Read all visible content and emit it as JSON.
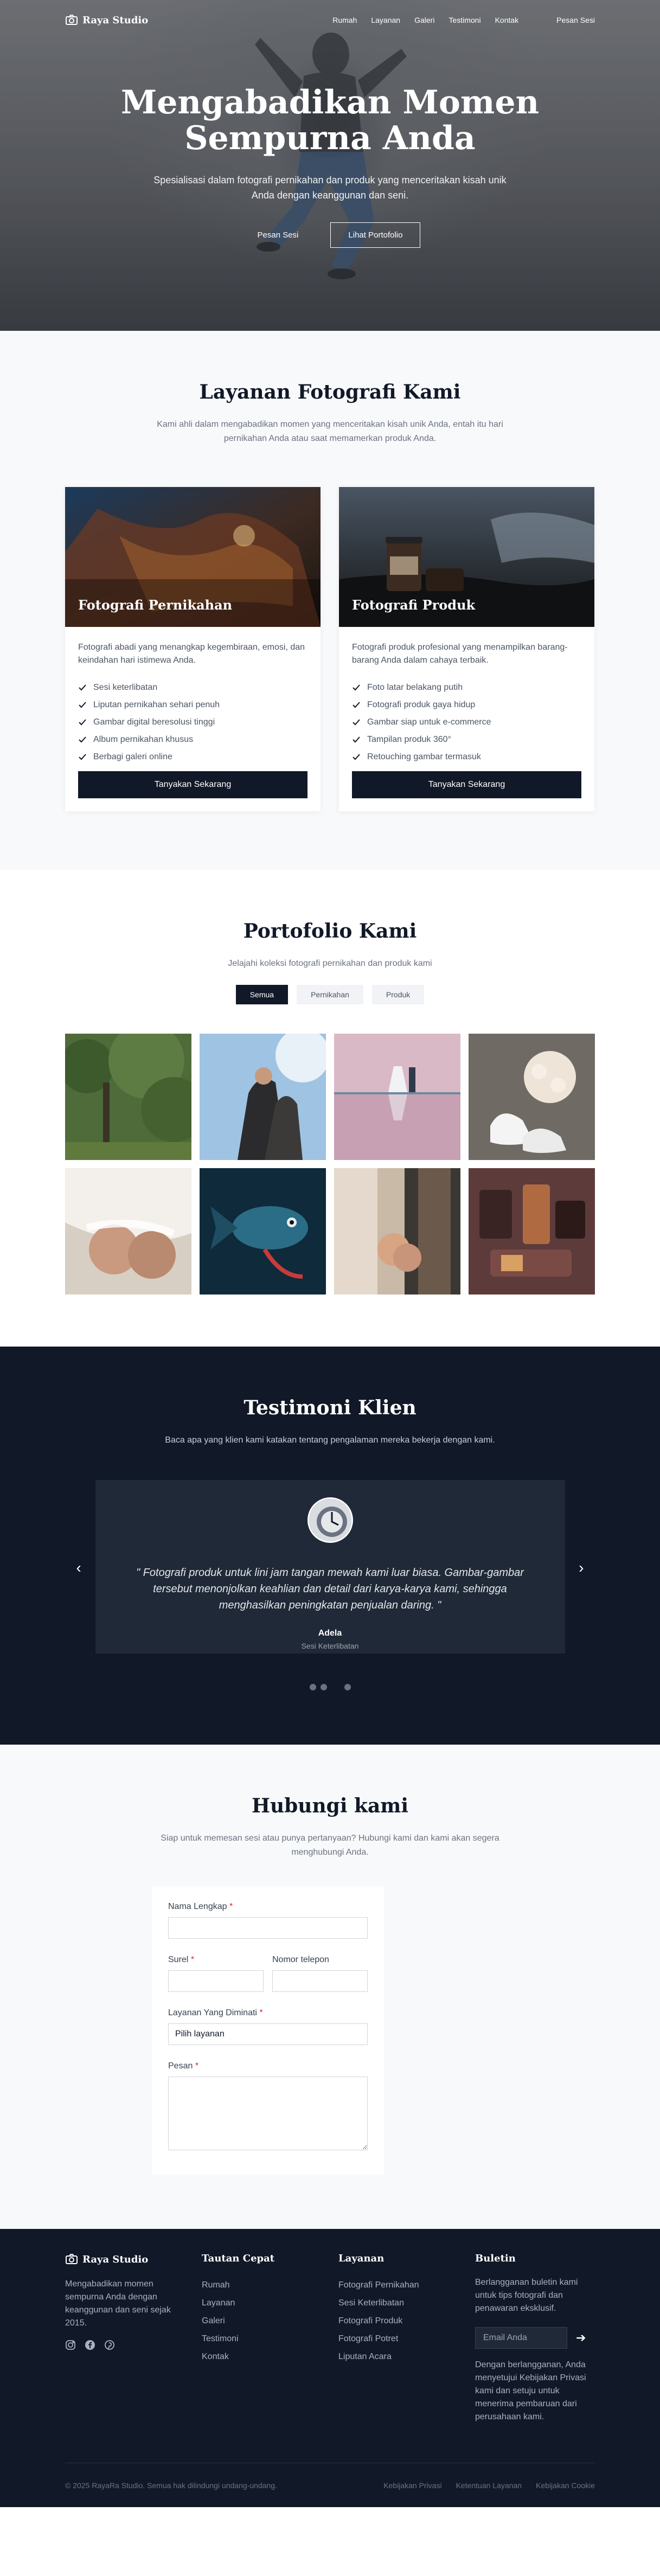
{
  "nav": {
    "brand": "Raya Studio",
    "links": [
      "Rumah",
      "Layanan",
      "Galeri",
      "Testimoni",
      "Kontak"
    ],
    "cta": "Pesan Sesi"
  },
  "hero": {
    "title": "Mengabadikan Momen Sempurna Anda",
    "subtitle": "Spesialisasi dalam fotografi pernikahan dan produk yang menceritakan kisah unik Anda dengan keanggunan dan seni.",
    "primary_button": "Pesan Sesi",
    "secondary_button": "Lihat Portofolio"
  },
  "services": {
    "title": "Layanan Fotografi Kami",
    "subtitle": "Kami ahli dalam mengabadikan momen yang menceritakan kisah unik Anda, entah itu hari pernikahan Anda atau saat memamerkan produk Anda.",
    "cards": [
      {
        "title": "Fotografi Pernikahan",
        "description": "Fotografi abadi yang menangkap kegembiraan, emosi, dan keindahan hari istimewa Anda.",
        "features": [
          "Sesi keterlibatan",
          "Liputan pernikahan sehari penuh",
          "Gambar digital beresolusi tinggi",
          "Album pernikahan khusus",
          "Berbagi galeri online"
        ],
        "button": "Tanyakan Sekarang"
      },
      {
        "title": "Fotografi Produk",
        "description": "Fotografi produk profesional yang menampilkan barang-barang Anda dalam cahaya terbaik.",
        "features": [
          "Foto latar belakang putih",
          "Fotografi produk gaya hidup",
          "Gambar siap untuk e-commerce",
          "Tampilan produk 360°",
          "Retouching gambar termasuk"
        ],
        "button": "Tanyakan Sekarang"
      }
    ]
  },
  "portfolio": {
    "title": "Portofolio Kami",
    "subtitle": "Jelajahi koleksi fotografi pernikahan dan produk kami",
    "filters": [
      "Semua",
      "Pernikahan",
      "Produk"
    ],
    "active_filter": "Semua"
  },
  "testimonials": {
    "title": "Testimoni Klien",
    "subtitle": "Baca apa yang klien kami katakan tentang pengalaman mereka bekerja dengan kami.",
    "quote": "\" Fotografi produk untuk lini jam tangan mewah kami luar biasa. Gambar-gambar tersebut menonjolkan keahlian dan detail dari karya-karya kami, sehingga menghasilkan peningkatan penjualan daring. \"",
    "author": "Adela",
    "role": "Sesi Keterlibatan",
    "prev_arrow": "‹",
    "next_arrow": "›"
  },
  "contact": {
    "title": "Hubungi kami",
    "subtitle": "Siap untuk memesan sesi atau punya pertanyaan? Hubungi kami dan kami akan segera menghubungi Anda.",
    "full_name_label": "Nama Lengkap",
    "email_label": "Surel",
    "phone_label": "Nomor telepon",
    "service_label": "Layanan Yang Diminati",
    "service_value": "Pilih layanan",
    "message_label": "Pesan",
    "required_mark": "*"
  },
  "footer": {
    "brand": "Raya Studio",
    "about": "Mengabadikan momen sempurna Anda dengan keanggunan dan seni sejak 2015.",
    "quick_links_title": "Tautan Cepat",
    "quick_links": [
      "Rumah",
      "Layanan",
      "Galeri",
      "Testimoni",
      "Kontak"
    ],
    "services_title": "Layanan",
    "services": [
      "Fotografi Pernikahan",
      "Sesi Keterlibatan",
      "Fotografi Produk",
      "Fotografi Potret",
      "Liputan Acara"
    ],
    "newsletter_title": "Buletin",
    "newsletter_text": "Berlangganan buletin kami untuk tips fotografi dan penawaran eksklusif.",
    "newsletter_placeholder": "Email Anda",
    "newsletter_button": "➔",
    "newsletter_fine": "Dengan berlangganan, Anda menyetujui Kebijakan Privasi kami dan setuju untuk menerima pembaruan dari perusahaan kami.",
    "copyright": "© 2025 RayaRa Studio. Semua hak dilindungi undang-undang.",
    "legal": [
      "Kebijakan Privasi",
      "Ketentuan Layanan",
      "Kebijakan Cookie"
    ]
  },
  "colors": {
    "dark": "#111827",
    "card_dark": "#1f2937",
    "light_bg": "#f8f9fb",
    "required": "#dc2626"
  }
}
